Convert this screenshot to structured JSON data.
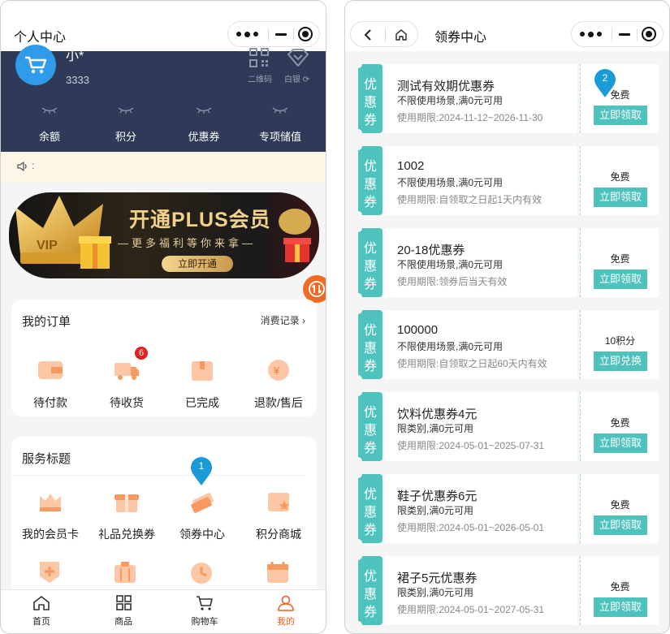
{
  "profile": {
    "nav_title": "个人中心",
    "user": {
      "name": "小*",
      "id": "3333"
    },
    "qr_label": "二维码",
    "silver_label": "白银",
    "stats": [
      "余额",
      "积分",
      "优惠券",
      "专项储值"
    ],
    "banner": {
      "title": "开通PLUS会员",
      "subtitle": "—更多福利等你来拿—",
      "button": "立即开通"
    },
    "orders": {
      "title": "我的订单",
      "link": "消费记录",
      "items": [
        {
          "label": "待付款"
        },
        {
          "label": "待收货",
          "badge": "6"
        },
        {
          "label": "已完成"
        },
        {
          "label": "退款/售后"
        }
      ]
    },
    "services": {
      "title": "服务标题",
      "items": [
        "我的会员卡",
        "礼品兑换券",
        "领券中心",
        "积分商城"
      ],
      "marker": "1"
    },
    "tabs": [
      "首页",
      "商品",
      "购物车",
      "我的"
    ],
    "active_tab": "我的"
  },
  "coupon_center": {
    "nav_title": "领券中心",
    "stub_text": [
      "优",
      "惠",
      "券"
    ],
    "marker": "2",
    "coupons": [
      {
        "title": "测试有效期优惠券",
        "condition": "不限使用场景,满0元可用",
        "validity": "使用期限:2024-11-12~2026-11-30",
        "price": "免费",
        "button": "立即领取"
      },
      {
        "title": "1002",
        "condition": "不限使用场景,满0元可用",
        "validity": "使用期限:自领取之日起1天内有效",
        "price": "免费",
        "button": "立即领取"
      },
      {
        "title": "20-18优惠券",
        "condition": "不限使用场景,满0元可用",
        "validity": "使用期限:领券后当天有效",
        "price": "免费",
        "button": "立即领取"
      },
      {
        "title": "100000",
        "condition": "不限使用场景,满0元可用",
        "validity": "使用期限:自领取之日起60天内有效",
        "price": "10积分",
        "button": "立即兑换"
      },
      {
        "title": "饮料优惠券4元",
        "condition": "限类别,满0元可用",
        "validity": "使用期限:2024-05-01~2025-07-31",
        "price": "免费",
        "button": "立即领取"
      },
      {
        "title": "鞋子优惠券6元",
        "condition": "限类别,满0元可用",
        "validity": "使用期限:2024-05-01~2026-05-01",
        "price": "免费",
        "button": "立即领取"
      },
      {
        "title": "裙子5元优惠券",
        "condition": "限类别,满0元可用",
        "validity": "使用期限:2024-05-01~2027-05-31",
        "price": "免费",
        "button": "立即领取"
      }
    ]
  },
  "colors": {
    "header": "#2e3a57",
    "accent": "#f25c1e",
    "teal": "#4ec3bd",
    "marker": "#1a9bd7"
  }
}
